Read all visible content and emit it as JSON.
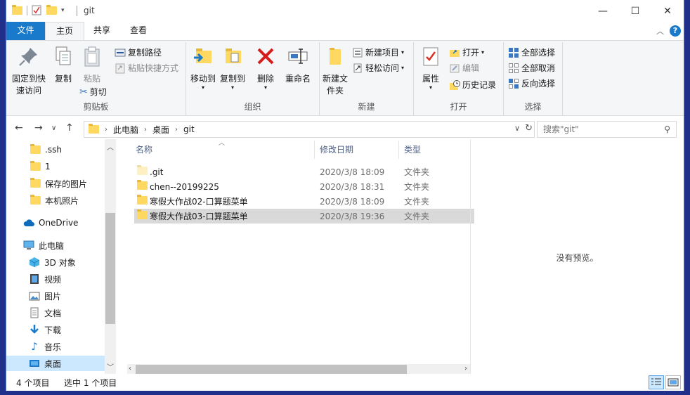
{
  "window": {
    "title": "git",
    "minimize": "—",
    "maximize": "☐",
    "close": "✕"
  },
  "tabs": [
    {
      "label": "文件"
    },
    {
      "label": "主页"
    },
    {
      "label": "共享"
    },
    {
      "label": "查看"
    }
  ],
  "ribbon": {
    "clipboard": {
      "group": "剪贴板",
      "pin": "固定到快速访问",
      "copy": "复制",
      "paste": "粘贴",
      "copy_path": "复制路径",
      "paste_shortcut": "粘贴快捷方式",
      "cut": "剪切"
    },
    "organize": {
      "group": "组织",
      "move_to": "移动到",
      "copy_to": "复制到",
      "delete": "删除",
      "rename": "重命名"
    },
    "new": {
      "group": "新建",
      "new_folder": "新建文件夹",
      "new_item": "新建项目",
      "easy_access": "轻松访问"
    },
    "open": {
      "group": "打开",
      "properties": "属性",
      "open": "打开",
      "edit": "编辑",
      "history": "历史记录"
    },
    "select": {
      "group": "选择",
      "select_all": "全部选择",
      "select_none": "全部取消",
      "invert": "反向选择"
    }
  },
  "address": {
    "crumbs": [
      "此电脑",
      "桌面",
      "git"
    ],
    "search_placeholder": "搜索\"git\""
  },
  "nav_pane": {
    "items": [
      {
        "label": ".ssh",
        "icon": "folder-icon"
      },
      {
        "label": "1",
        "icon": "folder-icon"
      },
      {
        "label": "保存的图片",
        "icon": "folder-icon"
      },
      {
        "label": "本机照片",
        "icon": "folder-icon"
      },
      {
        "label": "OneDrive",
        "icon": "cloud-icon"
      },
      {
        "label": "此电脑",
        "icon": "computer-icon"
      },
      {
        "label": "3D 对象",
        "icon": "cube-icon"
      },
      {
        "label": "视频",
        "icon": "video-icon"
      },
      {
        "label": "图片",
        "icon": "picture-icon"
      },
      {
        "label": "文档",
        "icon": "document-icon"
      },
      {
        "label": "下载",
        "icon": "download-icon"
      },
      {
        "label": "音乐",
        "icon": "music-icon"
      },
      {
        "label": "桌面",
        "icon": "desktop-icon"
      }
    ]
  },
  "columns": {
    "name": "名称",
    "date": "修改日期",
    "type": "类型"
  },
  "files": [
    {
      "name": ".git",
      "date": "2020/3/8 18:09",
      "type": "文件夹"
    },
    {
      "name": "chen--20199225",
      "date": "2020/3/8 18:31",
      "type": "文件夹"
    },
    {
      "name": "寒假大作战02-口算题菜单",
      "date": "2020/3/8 18:09",
      "type": "文件夹"
    },
    {
      "name": "寒假大作战03-口算题菜单",
      "date": "2020/3/8 19:36",
      "type": "文件夹"
    }
  ],
  "preview": {
    "message": "没有预览。"
  },
  "status": {
    "count": "4 个项目",
    "selected": "选中 1 个项目"
  },
  "colors": {
    "accent": "#1979ca",
    "folder": "#ffd862",
    "selection": "#d9d9d9"
  }
}
